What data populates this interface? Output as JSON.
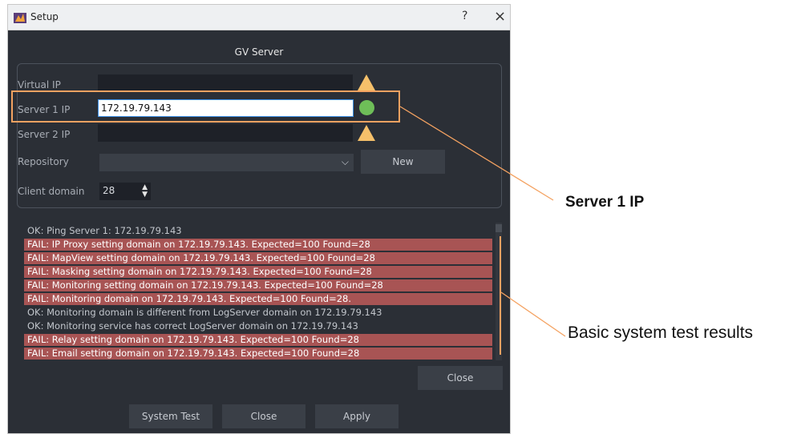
{
  "window": {
    "title": "Setup",
    "help_label": "?",
    "close_label": "×"
  },
  "section_title": "GV Server",
  "form": {
    "virtual_ip": {
      "label": "Virtual IP",
      "value": ""
    },
    "server1_ip": {
      "label": "Server 1 IP",
      "value": "172.19.79.143"
    },
    "server2_ip": {
      "label": "Server 2 IP",
      "value": ""
    },
    "repository": {
      "label": "Repository",
      "value": ""
    },
    "new_label": "New",
    "client_domain": {
      "label": "Client domain",
      "value": "28"
    }
  },
  "results": [
    {
      "text": "OK: Ping Server 1: 172.19.79.143",
      "status": "ok"
    },
    {
      "text": "FAIL: IP Proxy setting domain on 172.19.79.143. Expected=100 Found=28",
      "status": "fail"
    },
    {
      "text": "FAIL: MapView setting domain on 172.19.79.143. Expected=100 Found=28",
      "status": "fail"
    },
    {
      "text": "FAIL: Masking setting domain on 172.19.79.143. Expected=100 Found=28",
      "status": "fail"
    },
    {
      "text": "FAIL: Monitoring setting domain on 172.19.79.143. Expected=100 Found=28",
      "status": "fail"
    },
    {
      "text": "FAIL: Monitoring domain on 172.19.79.143. Expected=100 Found=28.",
      "status": "fail"
    },
    {
      "text": "OK: Monitoring domain is different from LogServer domain on 172.19.79.143",
      "status": "ok"
    },
    {
      "text": "OK: Monitoring service has correct LogServer domain on 172.19.79.143",
      "status": "ok"
    },
    {
      "text": "FAIL: Relay setting domain on 172.19.79.143. Expected=100 Found=28",
      "status": "fail"
    },
    {
      "text": "FAIL: Email setting domain on 172.19.79.143. Expected=100 Found=28",
      "status": "fail"
    }
  ],
  "results_close_label": "Close",
  "footer": {
    "system_test_label": "System Test",
    "close_label": "Close",
    "apply_label": "Apply"
  },
  "callouts": {
    "server1": "Server 1 IP",
    "results": "Basic system test results"
  },
  "colors": {
    "accent_orange": "#f4a261",
    "fail_row": "#a85454",
    "status_ok": "#6ebe58",
    "warning": "#f5c06a"
  }
}
